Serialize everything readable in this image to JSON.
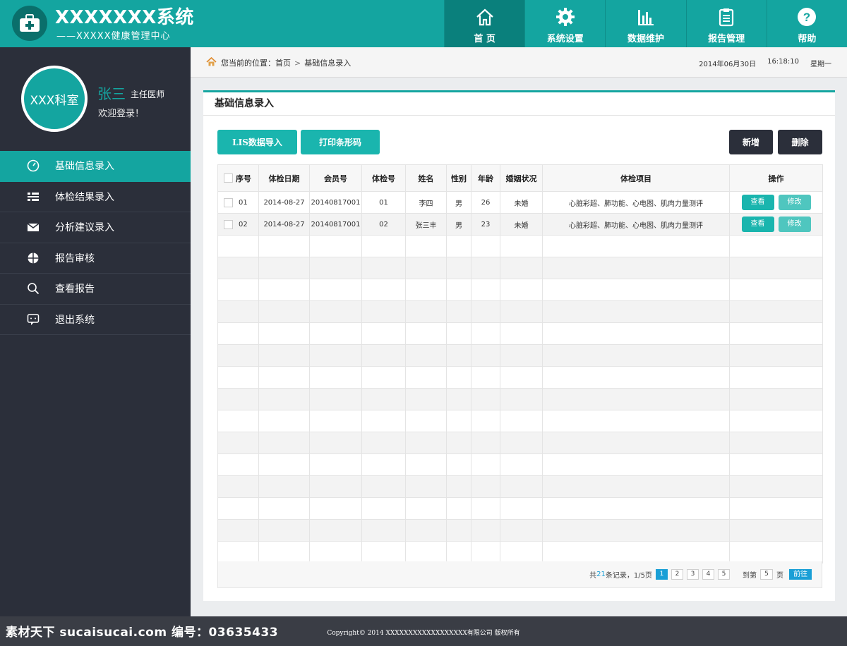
{
  "brand": {
    "title": "XXXXXXX系统",
    "subtitle": "——XXXXX健康管理中心"
  },
  "topnav": [
    {
      "label": "首 页",
      "icon": "home-icon"
    },
    {
      "label": "系统设置",
      "icon": "gear-icon"
    },
    {
      "label": "数据维护",
      "icon": "bar-chart-icon"
    },
    {
      "label": "报告管理",
      "icon": "clipboard-icon"
    },
    {
      "label": "帮助",
      "icon": "help-icon"
    }
  ],
  "profile": {
    "dept": "XXX科室",
    "name": "张三",
    "role": "主任医师",
    "welcome": "欢迎登录！"
  },
  "menu": [
    {
      "label": "基础信息录入",
      "icon": "dashboard-icon"
    },
    {
      "label": "体检结果录入",
      "icon": "list-icon"
    },
    {
      "label": "分析建议录入",
      "icon": "mail-icon"
    },
    {
      "label": "报告审核",
      "icon": "pie-icon"
    },
    {
      "label": "查看报告",
      "icon": "search-icon"
    },
    {
      "label": "退出系统",
      "icon": "logout-icon"
    }
  ],
  "breadcrumb": {
    "prefix": "您当前的位置：",
    "home": "首页",
    "current": "基础信息录入"
  },
  "datetime": {
    "date": "2014年06月30日",
    "time": "16:18:10",
    "weekday": "星期一"
  },
  "panel": {
    "title": "基础信息录入"
  },
  "toolbar": {
    "lis_import": "LIS数据导入",
    "print_barcode": "打印条形码",
    "add": "新增",
    "delete": "删除"
  },
  "table": {
    "headers": [
      "序号",
      "体检日期",
      "会员号",
      "体检号",
      "姓名",
      "性别",
      "年龄",
      "婚姻状况",
      "体检项目",
      "操作"
    ],
    "rows": [
      {
        "no": "01",
        "date": "2014-08-27",
        "member": "20140817001",
        "exam": "01",
        "name": "李四",
        "gender": "男",
        "age": "26",
        "marital": "未婚",
        "items": "心脏彩超、肺功能、心电图、肌肉力量测评",
        "view": "查看",
        "edit": "修改"
      },
      {
        "no": "02",
        "date": "2014-08-27",
        "member": "20140817001",
        "exam": "02",
        "name": "张三丰",
        "gender": "男",
        "age": "23",
        "marital": "未婚",
        "items": "心脏彩超、肺功能、心电图、肌肉力量测评",
        "view": "查看",
        "edit": "修改"
      }
    ]
  },
  "pager": {
    "total_prefix": "共",
    "total": "21",
    "total_suffix": "条记录，",
    "page_info": "1/5页",
    "pages": [
      "1",
      "2",
      "3",
      "4",
      "5"
    ],
    "goto_prefix": "到第",
    "goto_value": "5",
    "goto_suffix": "页",
    "go": "前往"
  },
  "footer": {
    "copyright": "Copyright© 2014   XXXXXXXXXXXXXXXXXX有限公司  版权所有",
    "watermark": "素材天下 sucaisucai.com  编号：03635433"
  },
  "colors": {
    "accent": "#14a5a0",
    "sidebar": "#2b2f3a",
    "link": "#1a9fd6"
  }
}
